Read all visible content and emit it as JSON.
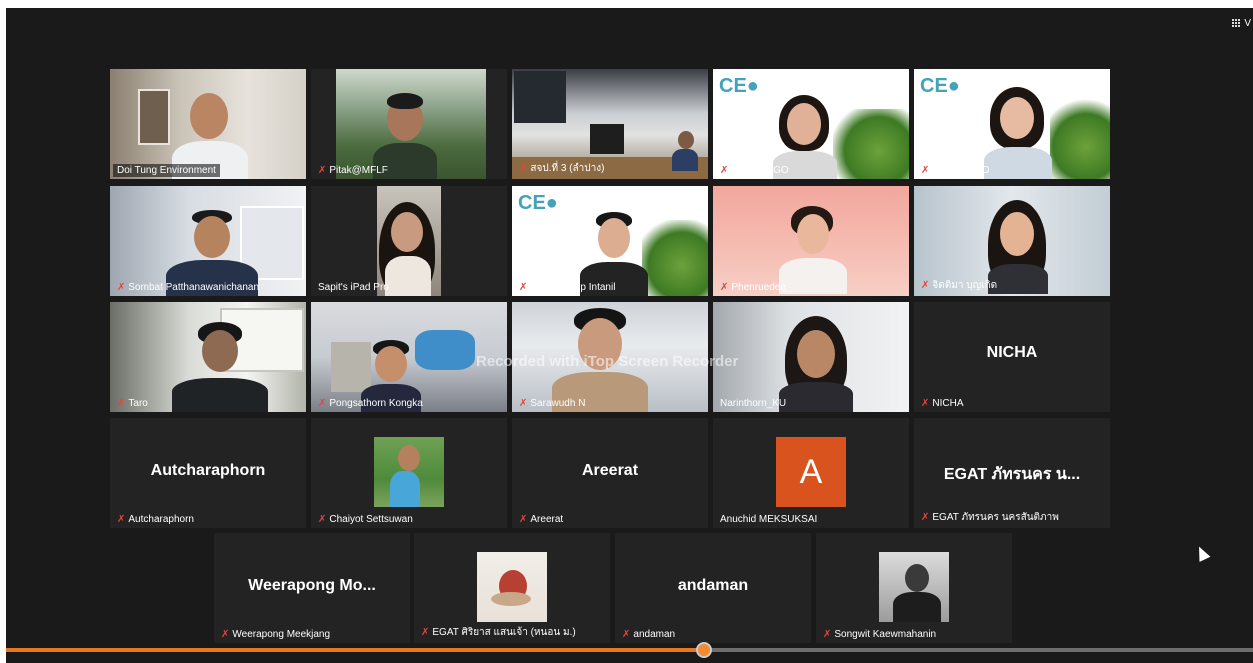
{
  "toolbar": {
    "view_label": "V"
  },
  "watermark": "Recorded with iTop Screen Recorder",
  "colors": {
    "active_speaker": "#c6d62e",
    "muted_mic": "#e5443b",
    "progress": "#e87722",
    "avatar_a": "#d9531e"
  },
  "playback": {
    "progress_fraction": 0.56
  },
  "participants": {
    "p01": {
      "name": "Doi Tung Environment",
      "muted": false
    },
    "p02": {
      "name": "Pitak@MFLF",
      "muted": true
    },
    "p03": {
      "name": "สจป.ที่ 3 (ลำปาง)",
      "muted": true
    },
    "p04": {
      "name": "Pranee-TGO",
      "muted": true
    },
    "p05": {
      "name": "siriporn TGO",
      "muted": true
    },
    "p06": {
      "name": "Sombat Patthanawanichanan",
      "muted": true
    },
    "p07": {
      "name": "Sapit's iPad Pro",
      "muted": false
    },
    "p08": {
      "name": "TGO Punlop Intanil",
      "muted": true
    },
    "p09": {
      "name": "Phenruedee",
      "muted": true
    },
    "p10": {
      "name": "จิตติมา บุญเกิด",
      "muted": true
    },
    "p11": {
      "name": "Taro",
      "muted": true
    },
    "p12": {
      "name": "Pongsathorn Kongka",
      "muted": true
    },
    "p13": {
      "name": "Sarawudh N",
      "muted": true
    },
    "p14": {
      "name": "Narinthorn_KU",
      "muted": false
    },
    "p15": {
      "name": "NICHA",
      "display": "NICHA",
      "muted": true
    },
    "p16": {
      "name": "Autcharaphorn",
      "display": "Autcharaphorn",
      "muted": true
    },
    "p17": {
      "name": "Chaiyot Settsuwan",
      "muted": true
    },
    "p18": {
      "name": "Areerat",
      "display": "Areerat",
      "muted": true
    },
    "p19": {
      "name": "Anuchid MEKSUKSAI",
      "avatar_letter": "A",
      "muted": false
    },
    "p20": {
      "name": "EGAT ภัทรนคร นครสันติภาพ",
      "display": "EGAT ภัทรนคร น...",
      "muted": true
    },
    "p21": {
      "name": "Weerapong Meekjang",
      "display": "Weerapong  Mo...",
      "muted": true
    },
    "p22": {
      "name": "EGAT ศิริยาส แสนเจ้า (หนอน ม.)",
      "muted": true
    },
    "p23": {
      "name": "andaman",
      "display": "andaman",
      "muted": true
    },
    "p24": {
      "name": "Songwit Kaewmahanin",
      "muted": true
    }
  }
}
